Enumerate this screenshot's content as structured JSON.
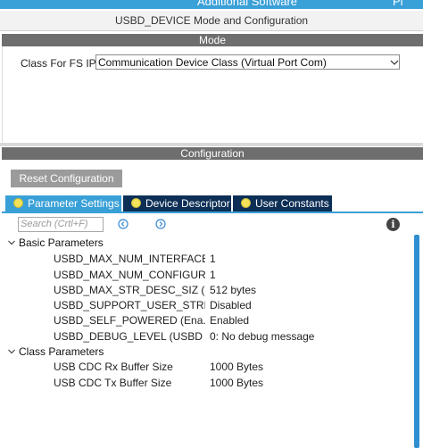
{
  "window": {
    "header_partial": "Additional Software",
    "header_right_partial": "Pi",
    "title": "USBD_DEVICE Mode and Configuration"
  },
  "mode": {
    "header": "Mode",
    "class_label": "Class For FS IP",
    "class_value": "Communication Device Class (Virtual Port Com)"
  },
  "configuration": {
    "header": "Configuration",
    "reset_label": "Reset Configuration",
    "tabs": [
      {
        "label": "Parameter Settings",
        "active": true
      },
      {
        "label": "Device Descriptor",
        "active": false
      },
      {
        "label": "User Constants",
        "active": false
      }
    ],
    "search_placeholder": "Search (Crtl+F)",
    "info_glyph": "i",
    "groups": [
      {
        "label": "Basic Parameters",
        "rows": [
          {
            "key": "USBD_MAX_NUM_INTERFACE...",
            "value": "1"
          },
          {
            "key": "USBD_MAX_NUM_CONFIGUR...",
            "value": "1"
          },
          {
            "key": "USBD_MAX_STR_DESC_SIZ (...",
            "value": "512 bytes"
          },
          {
            "key": "USBD_SUPPORT_USER_STRI...",
            "value": "Disabled"
          },
          {
            "key": "USBD_SELF_POWERED (Ena...",
            "value": "Enabled"
          },
          {
            "key": "USBD_DEBUG_LEVEL (USBD ...",
            "value": "0: No debug message"
          }
        ]
      },
      {
        "label": "Class Parameters",
        "rows": [
          {
            "key": "USB CDC Rx Buffer Size",
            "value": "1000 Bytes"
          },
          {
            "key": "USB CDC Tx Buffer Size",
            "value": "1000 Bytes"
          }
        ]
      }
    ]
  },
  "colors": {
    "accent": "#39a0d7",
    "tab_inactive": "#0d2f56",
    "section_header": "#6e6e6e",
    "button_gray": "#9b9b9b"
  },
  "icons": {
    "expand": "chevron-down-icon",
    "prev": "arrow-left-circle-icon",
    "next": "arrow-right-circle-icon",
    "info": "info-icon",
    "tab_status": "status-dot-icon"
  }
}
